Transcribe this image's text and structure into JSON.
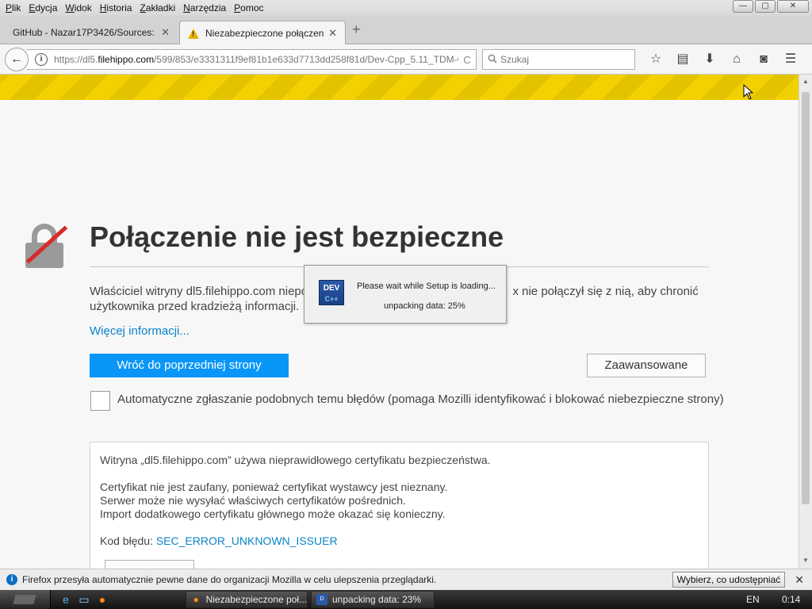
{
  "menu": [
    "Plik",
    "Edycja",
    "Widok",
    "Historia",
    "Zakładki",
    "Narzędzia",
    "Pomoc"
  ],
  "window_controls": {
    "minimize": "—",
    "maximize": "▢",
    "close": "✕"
  },
  "tabs": [
    {
      "title": "GitHub - Nazar17P3426/Sources: ...",
      "close": "✕"
    },
    {
      "title": "Niezabezpieczone połączenie",
      "close": "✕"
    }
  ],
  "new_tab": "+",
  "navbar": {
    "back": "←",
    "url_prefix": "https://dl5.",
    "url_domain": "filehippo.com",
    "url_rest": "/599/853/e3331311f9ef81b1e633d7713dd258f81d/Dev-Cpp_5.11_TDM-G",
    "reload": "C",
    "search_placeholder": "Szukaj",
    "icons": [
      "star-icon",
      "reading-list-icon",
      "download-icon",
      "home-icon",
      "pocket-icon",
      "menu-icon"
    ]
  },
  "error_page": {
    "title": "Połączenie nie jest bezpieczne",
    "description": "Właściciel witryny dl5.filehippo.com niepop... x nie połączył się z nią, aby chronić użytkownika przed kradzieżą informacji.",
    "desc_left": "Właściciel witryny dl5.filehippo.com niepop",
    "desc_right": "x nie połączył się z nią, aby chronić",
    "desc_line2": "użytkownika przed kradzieżą informacji.",
    "more_info": "Więcej informacji...",
    "back_button": "Wróć do poprzedniej strony",
    "advanced_button": "Zaawansowane",
    "checkbox_label": "Automatyczne zgłaszanie podobnych temu błędów (pomaga Mozilli identyfikować i blokować niebezpieczne strony)",
    "details": {
      "line1": "Witryna „dl5.filehippo.com” używa nieprawidłowego certyfikatu bezpieczeństwa.",
      "line2": "Certyfikat nie jest zaufany, ponieważ certyfikat wystawcy jest nieznany.",
      "line3": "Serwer może nie wysyłać właściwych certyfikatów pośrednich.",
      "line4": "Import dodatkowego certyfikatu głównego może okazać się konieczny.",
      "error_label": "Kod błędu:",
      "error_code": "SEC_ERROR_UNKNOWN_ISSUER"
    }
  },
  "setup_dialog": {
    "icon_text": "DEV",
    "icon_sub": "C++",
    "message": "Please wait while Setup is loading...",
    "progress": "unpacking data: 25%"
  },
  "notification": {
    "icon": "i",
    "text": "Firefox przesyła automatycznie pewne dane do organizacji Mozilla w celu ulepszenia przeglądarki.",
    "button": "Wybierz, co udostępniać",
    "close": "✕"
  },
  "taskbar": {
    "tasks": [
      {
        "label": "Niezabezpieczone poł...",
        "icon": "firefox-icon"
      },
      {
        "label": "unpacking data: 23%",
        "icon": "dev-cpp-icon"
      }
    ],
    "lang": "EN",
    "clock": "0:14"
  }
}
